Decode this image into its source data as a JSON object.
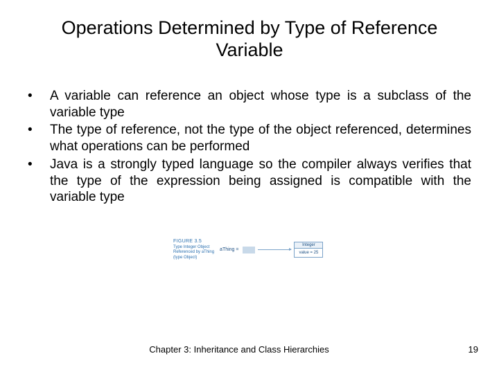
{
  "title": "Operations Determined by Type of Reference Variable",
  "bullets": [
    "A variable can reference an object whose type is a subclass of the variable type",
    "The type of reference, not the type of the object referenced, determines what operations can be performed",
    "Java is a strongly typed language so the compiler always verifies that the type of the expression being assigned is compatible with the variable type"
  ],
  "figure": {
    "label": "FIGURE 3.5",
    "caption_line1": "Type Integer Object",
    "caption_line2": "Referenced by aThing",
    "caption_line3": "(type Object)",
    "var_name": "aThing =",
    "obj_type": "Integer",
    "obj_value": "value = 25"
  },
  "footer": {
    "chapter": "Chapter 3: Inheritance and Class Hierarchies",
    "page": "19"
  }
}
